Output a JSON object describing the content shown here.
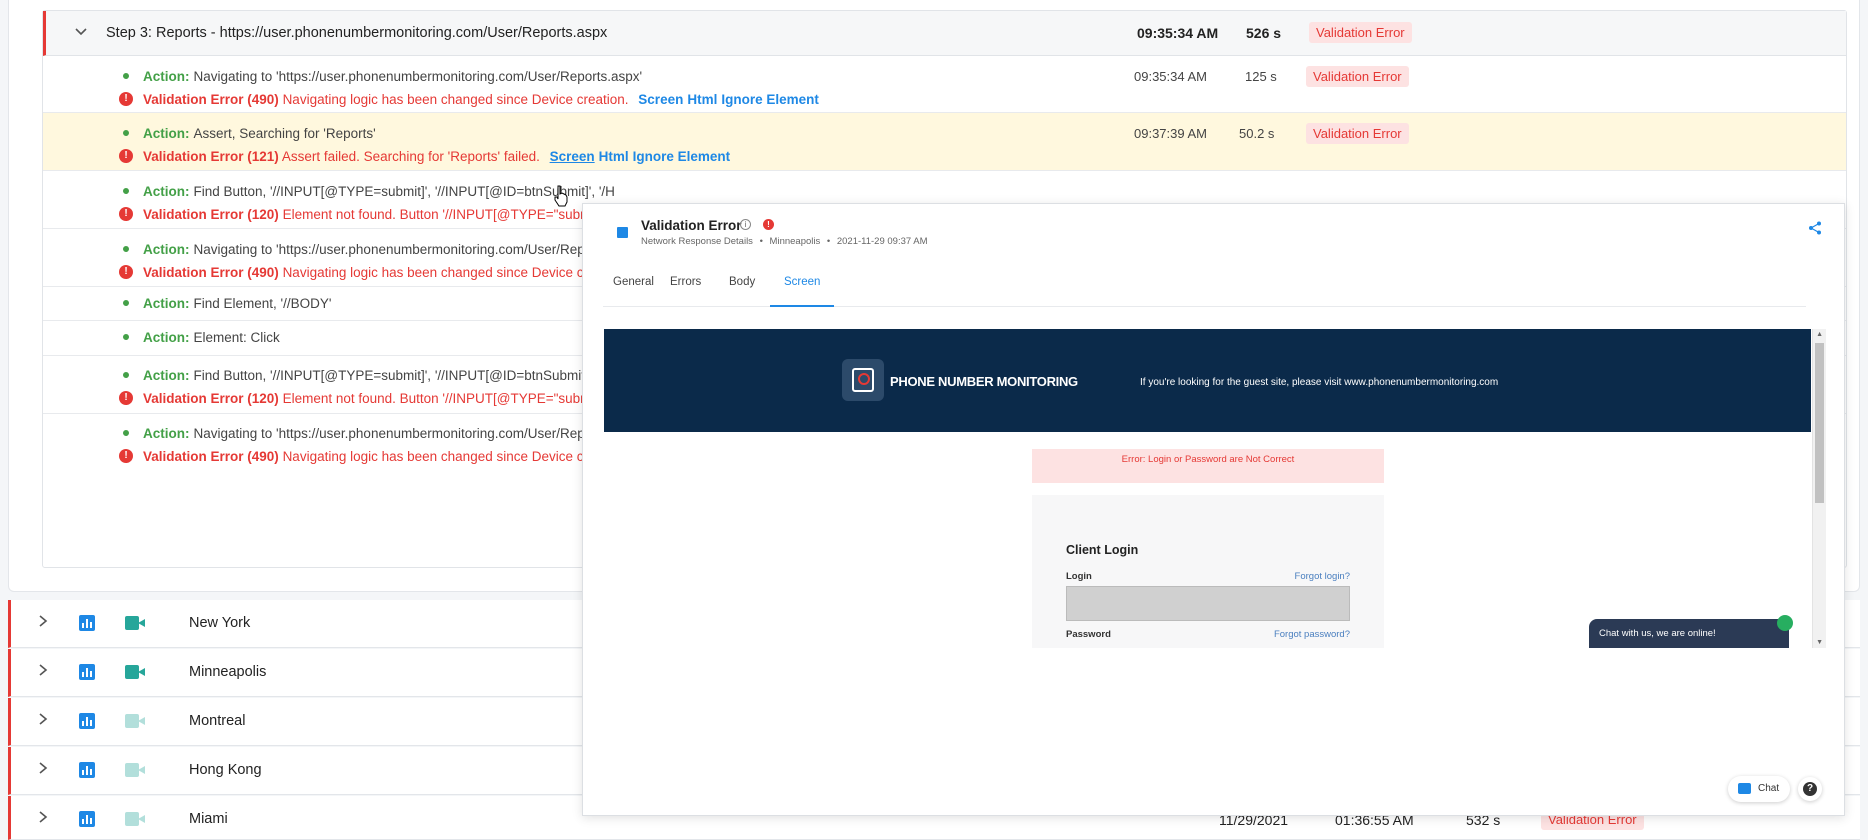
{
  "step": {
    "title": "Step 3:  Reports - https://user.phonenumbermonitoring.com/User/Reports.aspx",
    "time": "09:35:34 AM",
    "duration": "526 s",
    "status": "Validation Error"
  },
  "rows": [
    {
      "action_label": "Action:",
      "action_text": "Navigating to 'https://user.phonenumbermonitoring.com/User/Reports.aspx'",
      "time": "09:35:34 AM",
      "duration": "125 s",
      "status": "Validation Error",
      "error_strong": "Validation Error (490)",
      "error_text": "Navigating logic has been changed since Device creation.",
      "links": [
        "Screen",
        "Html",
        "Ignore Element"
      ]
    },
    {
      "action_label": "Action:",
      "action_text": "Assert, Searching for 'Reports'",
      "time": "09:37:39 AM",
      "duration": "50.2 s",
      "status": "Validation Error",
      "error_strong": "Validation Error (121)",
      "error_text": "Assert failed. Searching for 'Reports' failed.",
      "links": [
        "Screen",
        "Html",
        "Ignore Element"
      ]
    },
    {
      "action_label": "Action:",
      "action_text": "Find Button, '//INPUT[@TYPE=submit]', '//INPUT[@ID=btnSubmit]', '/H",
      "error_strong": "Validation Error (120)",
      "error_text": "Element not found. Button '//INPUT[@TYPE=\"submit\"]'."
    },
    {
      "action_label": "Action:",
      "action_text": "Navigating to 'https://user.phonenumbermonitoring.com/User/Repor",
      "error_strong": "Validation Error (490)",
      "error_text": "Navigating logic has been changed since Device creatio"
    },
    {
      "action_label": "Action:",
      "action_text": "Find Element, '//BODY'"
    },
    {
      "action_label": "Action:",
      "action_text": "Element: Click"
    },
    {
      "action_label": "Action:",
      "action_text": "Find Button, '//INPUT[@TYPE=submit]', '//INPUT[@ID=btnSubmit]', '/H",
      "error_strong": "Validation Error (120)",
      "error_text": "Element not found. Button '//INPUT[@TYPE=\"submit\"]'."
    },
    {
      "action_label": "Action:",
      "action_text": "Navigating to 'https://user.phonenumbermonitoring.com/User/Repor",
      "error_strong": "Validation Error (490)",
      "error_text": "Navigating logic has been changed since Device creatio"
    }
  ],
  "locations": [
    {
      "name": "New York",
      "cam_active": true
    },
    {
      "name": "Minneapolis",
      "cam_active": true
    },
    {
      "name": "Montreal",
      "cam_active": false
    },
    {
      "name": "Hong Kong",
      "cam_active": false
    },
    {
      "name": "Miami",
      "cam_active": false,
      "date": "11/29/2021",
      "time": "01:36:55 AM",
      "duration": "532 s",
      "status": "Validation Error"
    }
  ],
  "popup": {
    "title": "Validation Error",
    "sub_type": "Network Response Details",
    "sub_location": "Minneapolis",
    "sub_datetime": "2021-11-29 09:37 AM",
    "sub_sep": "•",
    "tabs": [
      "General",
      "Errors",
      "Body",
      "Screen"
    ],
    "active_tab": "Screen",
    "chat_label": "Chat",
    "help_label": "?"
  },
  "screenshot": {
    "brand": "PHONE NUMBER MONITORING",
    "banner_msg": "If you're looking for the guest site, please visit www.phonenumbermonitoring.com",
    "error_msg": "Error: Login or Password are Not Correct",
    "login_title": "Client Login",
    "login_label": "Login",
    "forgot_login": "Forgot login?",
    "password_label": "Password",
    "forgot_password": "Forgot password?",
    "chat_msg": "Chat with us, we are online!"
  },
  "colors": {
    "accent": "#1e88e5",
    "error": "#e53935",
    "success": "#43a047",
    "highlight": "#fff8de",
    "banner": "#0b2a4a"
  }
}
